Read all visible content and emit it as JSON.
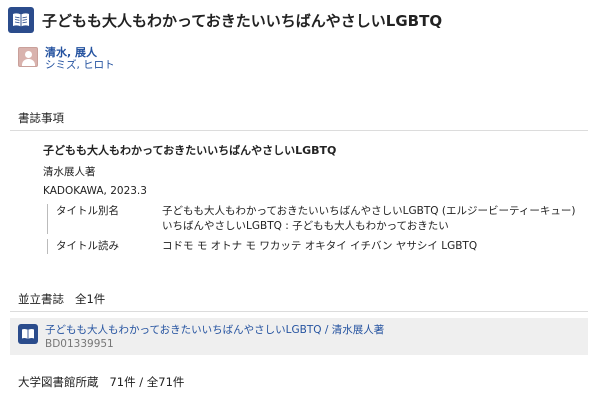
{
  "page": {
    "title": "子どもも大人もわかっておきたいいちばんやさしいLGBTQ"
  },
  "author": {
    "name": "清水, 展人",
    "reading": "シミズ, ヒロト"
  },
  "bibliographic": {
    "heading": "書誌事項",
    "title": "子どもも大人もわかっておきたいいちばんやさしいLGBTQ",
    "responsibility": "清水展人著",
    "publication": "KADOKAWA, 2023.3",
    "fields": [
      {
        "label": "タイトル別名",
        "values": [
          "子どもも大人もわかっておきたいいちばんやさしいLGBTQ (エルジービーティーキュー)",
          "いちばんやさしいLGBTQ : 子どもも大人もわかっておきたい"
        ]
      },
      {
        "label": "タイトル読み",
        "values": [
          "コドモ モ オトナ モ ワカッテ オキタイ イチバン ヤサシイ LGBTQ"
        ]
      }
    ]
  },
  "parallel": {
    "heading": "並立書誌",
    "count": "全1件",
    "item": {
      "link": "子どもも大人もわかっておきたいいちばんやさしいLGBTQ / 清水展人著",
      "id": "BD01339951"
    }
  },
  "holdings": {
    "heading": "大学図書館所蔵",
    "count": "71件 / 全71件"
  },
  "icons": {
    "book": "book-icon",
    "avatar": "person-icon"
  },
  "colors": {
    "link": "#2553a0",
    "icon_bg": "#2b4c8c"
  }
}
